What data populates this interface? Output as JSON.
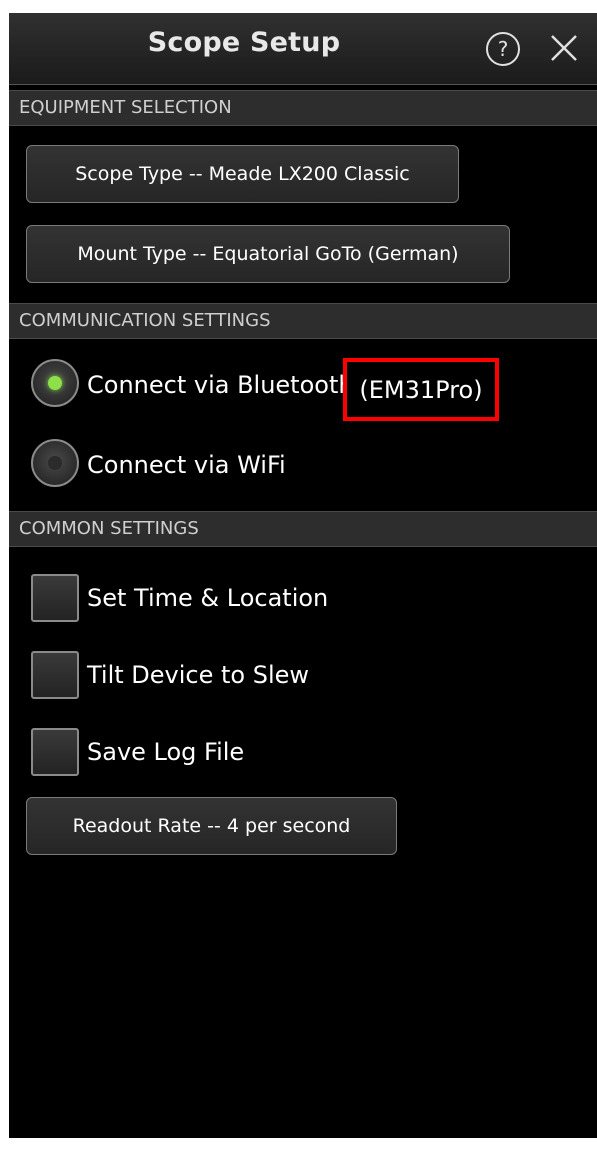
{
  "header": {
    "title": "Scope Setup",
    "help_icon_glyph": "?",
    "close_icon": "close-icon"
  },
  "equipment": {
    "section_label": "EQUIPMENT SELECTION",
    "scope_type_label": "Scope Type -- Meade LX200 Classic",
    "mount_type_label": "Mount Type -- Equatorial GoTo (German)"
  },
  "communication": {
    "section_label": "COMMUNICATION SETTINGS",
    "options": [
      {
        "label": "Connect via Bluetooth",
        "selected": true
      },
      {
        "label": "Connect via WiFi",
        "selected": false
      }
    ],
    "device_name": "(EM31Pro)"
  },
  "common": {
    "section_label": "COMMON SETTINGS",
    "checkboxes": [
      {
        "label": "Set Time & Location",
        "checked": false
      },
      {
        "label": "Tilt Device to Slew",
        "checked": false
      },
      {
        "label": "Save Log File",
        "checked": false
      }
    ],
    "readout_rate_label": "Readout Rate -- 4 per second"
  },
  "colors": {
    "background": "#000000",
    "radio_selected": "#8ee04a",
    "highlight_border": "#ff0000"
  }
}
